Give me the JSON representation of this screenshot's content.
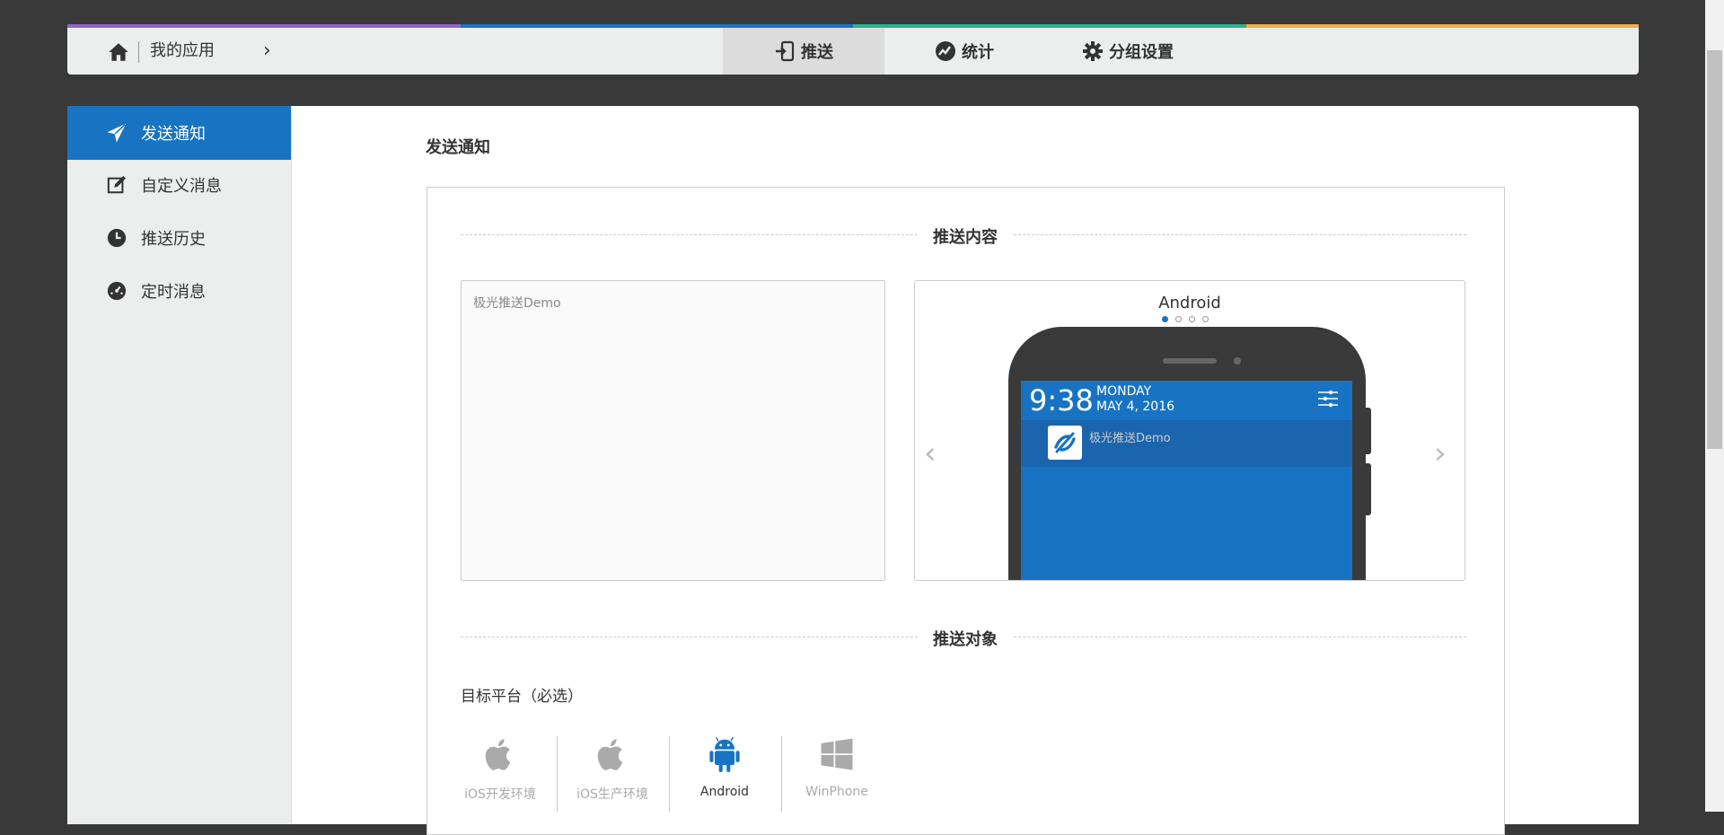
{
  "colors": {
    "strip": [
      "#9365c9",
      "#1c74c3",
      "#2bb38d",
      "#f0ae4b"
    ],
    "accent": "#1874c2"
  },
  "topbar": {
    "breadcrumb": "我的应用",
    "chevron": "›",
    "tabs": [
      {
        "label": "推送",
        "icon": "push-icon",
        "active": true
      },
      {
        "label": "统计",
        "icon": "chart-icon",
        "active": false
      },
      {
        "label": "分组设置",
        "icon": "gear-icon",
        "active": false
      }
    ]
  },
  "sidebar": {
    "items": [
      {
        "label": "发送通知",
        "icon": "send-icon",
        "active": true
      },
      {
        "label": "自定义消息",
        "icon": "edit-icon",
        "active": false
      },
      {
        "label": "推送历史",
        "icon": "clock-icon",
        "active": false
      },
      {
        "label": "定时消息",
        "icon": "timer-icon",
        "active": false
      }
    ]
  },
  "main": {
    "title": "发送通知",
    "content_section": "推送内容",
    "message_value": "极光推送Demo",
    "preview": {
      "platform": "Android",
      "slide_count": 4,
      "active_slide": 1,
      "time": "9:38",
      "day": "MONDAY",
      "date": "MAY 4, 2016",
      "notification_text": "极光推送Demo"
    },
    "target_section": "推送对象",
    "target_platform_label": "目标平台（必选）",
    "platforms": [
      {
        "label": "iOS开发环境",
        "icon": "apple-icon",
        "selected": false
      },
      {
        "label": "iOS生产环境",
        "icon": "apple-icon",
        "selected": false
      },
      {
        "label": "Android",
        "icon": "android-icon",
        "selected": true
      },
      {
        "label": "WinPhone",
        "icon": "windows-icon",
        "selected": false
      }
    ]
  }
}
